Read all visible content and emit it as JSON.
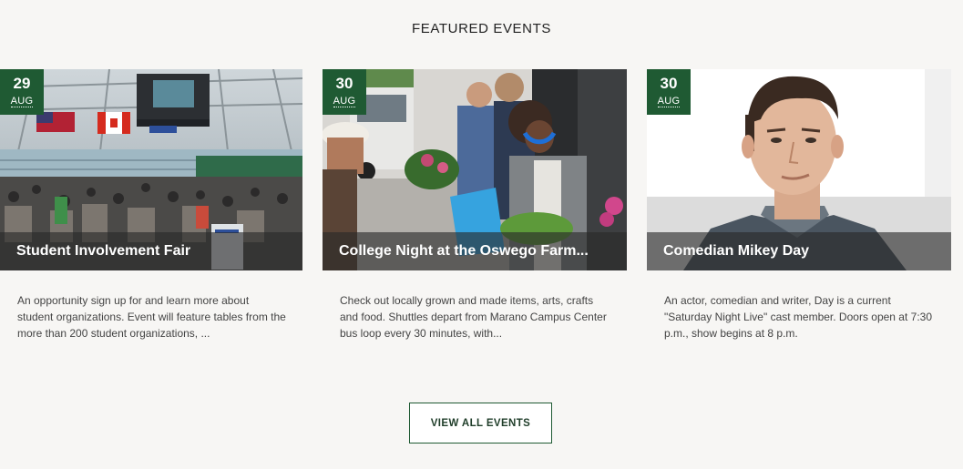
{
  "section": {
    "title": "FEATURED EVENTS"
  },
  "events": [
    {
      "day": "29",
      "month": "AUG",
      "title": "Student Involvement Fair",
      "description": "An opportunity sign up for and learn more about student organizations. Event will feature tables from the more than 200 student organizations, ..."
    },
    {
      "day": "30",
      "month": "AUG",
      "title": "College Night at the Oswego Farm...",
      "description": "Check out locally grown and made items, arts, crafts and food. Shuttles depart from Marano Campus Center bus loop every 30 minutes, with..."
    },
    {
      "day": "30",
      "month": "AUG",
      "title": "Comedian Mikey Day",
      "description": "An actor, comedian and writer, Day is a current \"Saturday Night Live\" cast member. Doors open at 7:30 p.m., show begins at 8 p.m."
    }
  ],
  "actions": {
    "view_all_label": "VIEW ALL EVENTS"
  },
  "colors": {
    "brand_green": "#1f5a33",
    "page_background": "#f7f6f4"
  }
}
